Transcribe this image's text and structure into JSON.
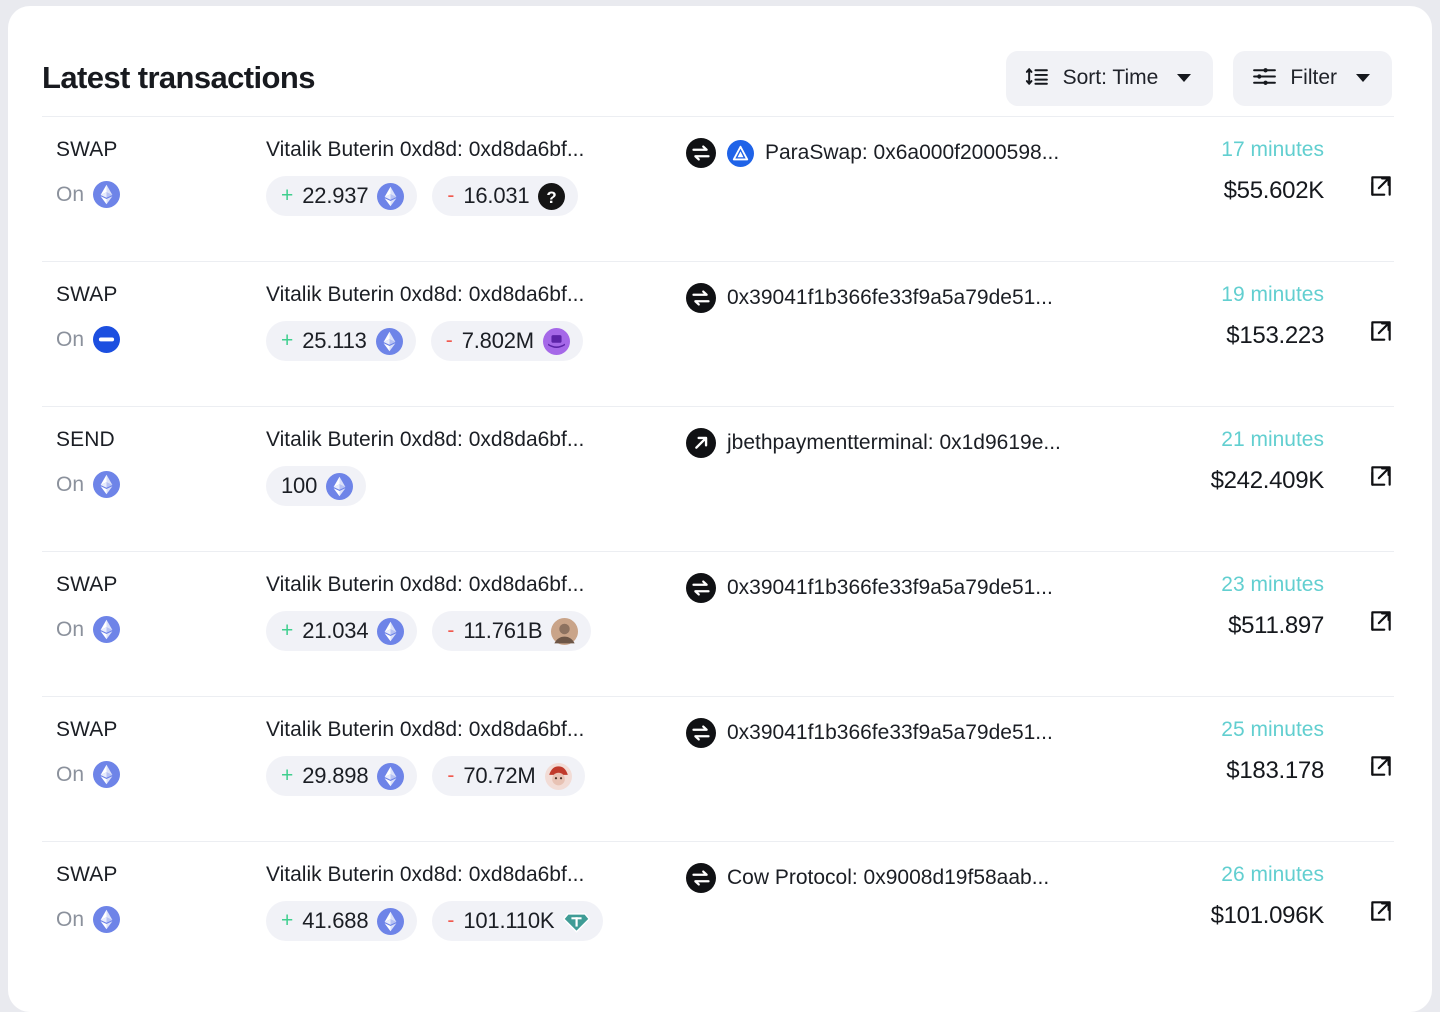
{
  "header": {
    "title": "Latest transactions",
    "sort_button": {
      "label": "Sort: Time",
      "icon": "sort-icon"
    },
    "filter_button": {
      "label": "Filter",
      "icon": "filter-sliders-icon"
    }
  },
  "colors": {
    "accent_time": "#62cfd0",
    "positive": "#3fcf8e",
    "negative": "#f1594e",
    "pill_bg": "#f1f2f7",
    "control_bg": "#f1f2f6",
    "text": "#1b1e24",
    "muted": "#8b919c",
    "ethereum": "#6e84e8",
    "base": "#1c4fe0",
    "paraswap": "#1f63e8",
    "unknown_token": "#151515",
    "purple_token": "#9a5ee0",
    "teal_token": "#3f9c96"
  },
  "labels": {
    "on": "On",
    "external_link": "open-transaction"
  },
  "transactions": [
    {
      "type": "SWAP",
      "chain_icon": "ethereum-icon",
      "from": "Vitalik Buterin 0xd8d: 0xd8da6bf...",
      "amounts": [
        {
          "sign": "+",
          "value": "22.937",
          "token_icon": "ethereum-token-icon"
        },
        {
          "sign": "-",
          "value": "16.031",
          "token_icon": "unknown-token-icon"
        }
      ],
      "action_icon": "swap-icon",
      "protocol_icon": "paraswap-icon",
      "to": "ParaSwap: 0x6a000f2000598...",
      "time": "17 minutes",
      "value": "$55.602K"
    },
    {
      "type": "SWAP",
      "chain_icon": "base-icon",
      "from": "Vitalik Buterin 0xd8d: 0xd8da6bf...",
      "amounts": [
        {
          "sign": "+",
          "value": "25.113",
          "token_icon": "ethereum-token-icon"
        },
        {
          "sign": "-",
          "value": "7.802M",
          "token_icon": "purple-hat-token-icon"
        }
      ],
      "action_icon": "swap-icon",
      "protocol_icon": null,
      "to": "0x39041f1b366fe33f9a5a79de51...",
      "time": "19 minutes",
      "value": "$153.223"
    },
    {
      "type": "SEND",
      "chain_icon": "ethereum-icon",
      "from": "Vitalik Buterin 0xd8d: 0xd8da6bf...",
      "amounts": [
        {
          "sign": "",
          "value": "100",
          "token_icon": "ethereum-token-icon"
        }
      ],
      "action_icon": "send-arrow-icon",
      "protocol_icon": null,
      "to": "jbethpaymentterminal: 0x1d9619e...",
      "time": "21 minutes",
      "value": "$242.409K"
    },
    {
      "type": "SWAP",
      "chain_icon": "ethereum-icon",
      "from": "Vitalik Buterin 0xd8d: 0xd8da6bf...",
      "amounts": [
        {
          "sign": "+",
          "value": "21.034",
          "token_icon": "ethereum-token-icon"
        },
        {
          "sign": "-",
          "value": "11.761B",
          "token_icon": "tan-avatar-token-icon"
        }
      ],
      "action_icon": "swap-icon",
      "protocol_icon": null,
      "to": "0x39041f1b366fe33f9a5a79de51...",
      "time": "23 minutes",
      "value": "$511.897"
    },
    {
      "type": "SWAP",
      "chain_icon": "ethereum-icon",
      "from": "Vitalik Buterin 0xd8d: 0xd8da6bf...",
      "amounts": [
        {
          "sign": "+",
          "value": "29.898",
          "token_icon": "ethereum-token-icon"
        },
        {
          "sign": "-",
          "value": "70.72M",
          "token_icon": "pink-avatar-token-icon"
        }
      ],
      "action_icon": "swap-icon",
      "protocol_icon": null,
      "to": "0x39041f1b366fe33f9a5a79de51...",
      "time": "25 minutes",
      "value": "$183.178"
    },
    {
      "type": "SWAP",
      "chain_icon": "ethereum-icon",
      "from": "Vitalik Buterin 0xd8d: 0xd8da6bf...",
      "amounts": [
        {
          "sign": "+",
          "value": "41.688",
          "token_icon": "ethereum-token-icon"
        },
        {
          "sign": "-",
          "value": "101.110K",
          "token_icon": "tether-gold-token-icon"
        }
      ],
      "action_icon": "swap-icon",
      "protocol_icon": null,
      "to": "Cow Protocol: 0x9008d19f58aab...",
      "time": "26 minutes",
      "value": "$101.096K"
    }
  ]
}
